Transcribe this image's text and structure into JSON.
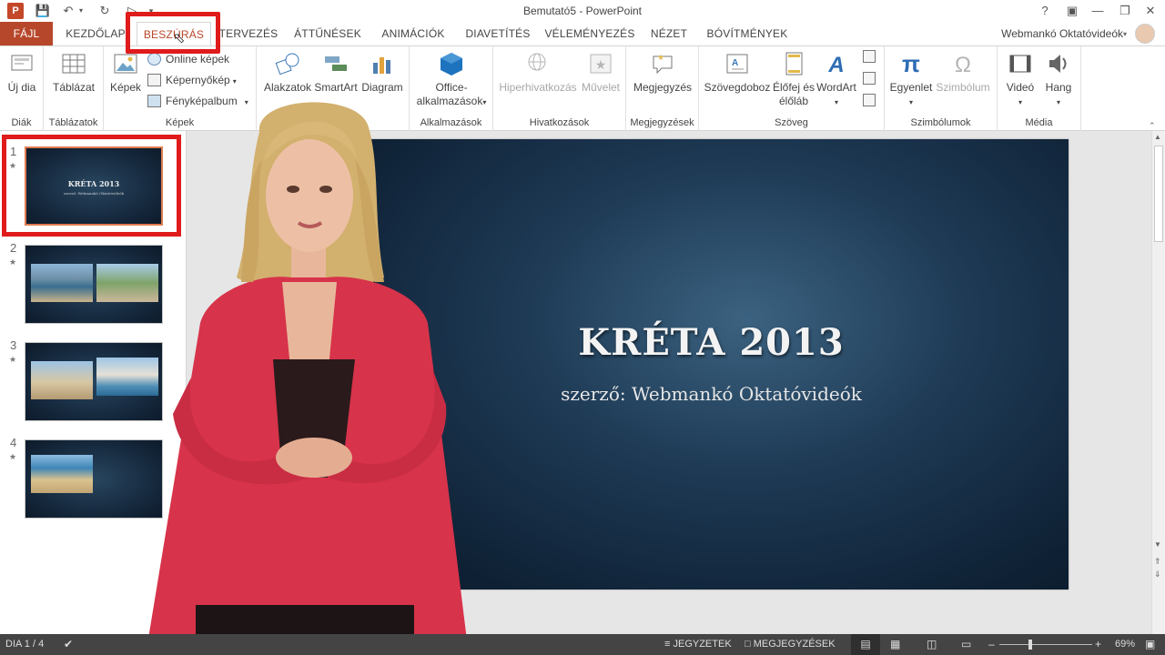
{
  "window": {
    "title": "Bemutató5 - PowerPoint",
    "account": "Webmankó Oktatóvideók"
  },
  "tabs": [
    "FÁJL",
    "KEZDŐLAP",
    "BESZÚRÁS",
    "TERVEZÉS",
    "ÁTTŰNÉSEK",
    "ANIMÁCIÓK",
    "DIAVETÍTÉS",
    "VÉLEMÉNYEZÉS",
    "NÉZET",
    "BÓVÍTMÉNYEK"
  ],
  "ribbon": {
    "groups": {
      "diak": "Diák",
      "tablazatok": "Táblázatok",
      "kepek": "Képek",
      "alkalmazasok": "Alkalmazások",
      "hivatkozasok": "Hivatkozások",
      "megjegyzesek": "Megjegyzések",
      "szoveg": "Szöveg",
      "szimbolumok": "Szimbólumok",
      "media": "Média"
    },
    "buttons": {
      "uj_dia": "Új dia",
      "tablazat": "Táblázat",
      "kepek": "Képek",
      "online_kepek": "Online képek",
      "kepernyokep": "Képernyőkép",
      "fenykepalbum": "Fényképalbum",
      "alakzatok": "Alakzatok",
      "smartart": "SmartArt",
      "diagram": "Diagram",
      "office_1": "Office-",
      "office_2": "alkalmazások",
      "hiperhivatkozas": "Hiperhivatkozás",
      "muvelet": "Művelet",
      "megjegyzes": "Megjegyzés",
      "szovegdoboz": "Szövegdoboz",
      "elofej_1": "Élőfej és",
      "elofej_2": "élőláb",
      "wordart": "WordArt",
      "egyenlet": "Egyenlet",
      "szimbolum": "Szimbólum",
      "video": "Videó",
      "hang": "Hang"
    }
  },
  "slides": [
    {
      "num": "1",
      "title": "KRÉTA 2013",
      "sub": "szerző: Webmankó Oktatóvideók"
    },
    {
      "num": "2"
    },
    {
      "num": "3"
    },
    {
      "num": "4"
    }
  ],
  "main_slide": {
    "title": "KRÉTA 2013",
    "subtitle": "szerző: Webmankó Oktatóvideók"
  },
  "status": {
    "slide": "DIA 1 / 4",
    "notes": "JEGYZETEK",
    "comments": "MEGJEGYZÉSEK",
    "zoom": "69%"
  },
  "colors": {
    "accent": "#b7472a",
    "highlight": "#e01b1b",
    "statusbar": "#444444"
  }
}
